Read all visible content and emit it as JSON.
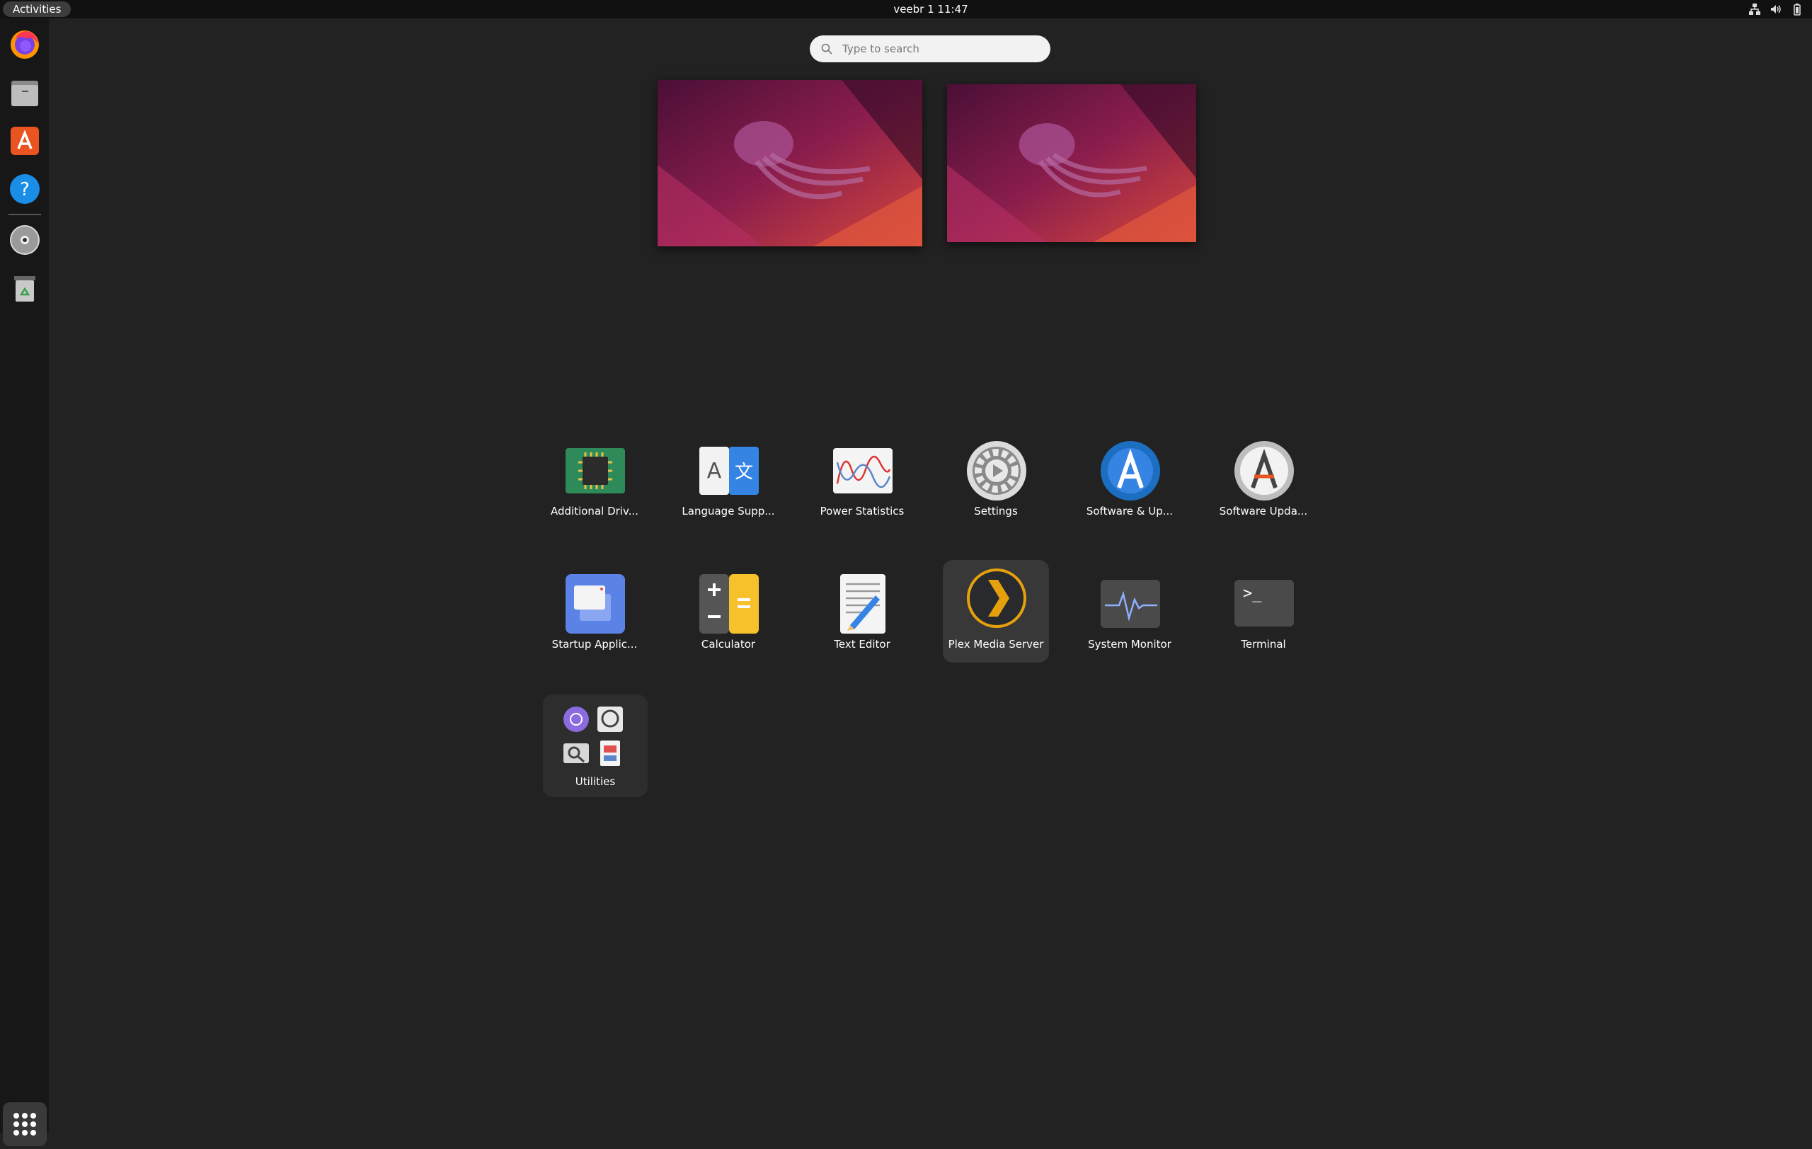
{
  "topbar": {
    "activities_label": "Activities",
    "clock": "veebr 1  11:47",
    "tray_icons": [
      "network-icon",
      "volume-icon",
      "battery-icon"
    ]
  },
  "dock": {
    "items": [
      "firefox-icon",
      "files-icon",
      "app-center-icon",
      "help-icon",
      "dvd-icon",
      "trash-icon"
    ],
    "show_apps": "show-apps-icon"
  },
  "search": {
    "placeholder": "Type to search"
  },
  "apps": [
    {
      "label": "Additional Driv...",
      "icon": "chip-icon"
    },
    {
      "label": "Language Supp...",
      "icon": "language-icon"
    },
    {
      "label": "Power Statistics",
      "icon": "power-statistics-icon"
    },
    {
      "label": "Settings",
      "icon": "gear-icon"
    },
    {
      "label": "Software & Up...",
      "icon": "software-updates-icon"
    },
    {
      "label": "Software Upda...",
      "icon": "software-updater-icon"
    },
    {
      "label": "Startup Applic...",
      "icon": "startup-icon"
    },
    {
      "label": "Calculator",
      "icon": "calculator-icon"
    },
    {
      "label": "Text Editor",
      "icon": "text-editor-icon"
    },
    {
      "label": "Plex Media Server",
      "icon": "plex-icon"
    },
    {
      "label": "System Monitor",
      "icon": "system-monitor-icon"
    },
    {
      "label": "Terminal",
      "icon": "terminal-icon"
    }
  ],
  "selected_app": "Plex Media Server",
  "folder": {
    "label": "Utilities",
    "icons": [
      "network-tool-icon",
      "disk-usage-icon",
      "image-viewer-icon",
      "document-viewer-icon"
    ]
  },
  "colors": {
    "background": "#222222",
    "topbar": "#111111",
    "dock": "#171717",
    "accent": "#e95420"
  }
}
